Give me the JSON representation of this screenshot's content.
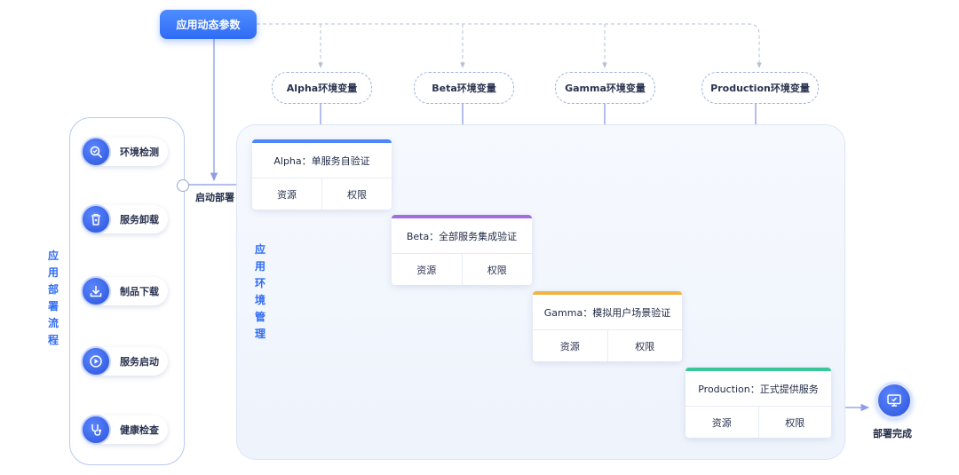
{
  "params": {
    "label": "应用动态参数"
  },
  "env_vars": [
    {
      "label": "Alpha环境变量"
    },
    {
      "label": "Beta环境变量"
    },
    {
      "label": "Gamma环境变量"
    },
    {
      "label": "Production环境变量"
    }
  ],
  "pipeline": {
    "title": "应用部署流程",
    "steps": [
      {
        "label": "环境检测",
        "icon": "search-check-icon"
      },
      {
        "label": "服务卸载",
        "icon": "trash-icon"
      },
      {
        "label": "制品下载",
        "icon": "download-icon"
      },
      {
        "label": "服务启动",
        "icon": "play-icon"
      },
      {
        "label": "健康检查",
        "icon": "stethoscope-icon"
      }
    ]
  },
  "deploy": {
    "label": "启动部署"
  },
  "env_area": {
    "title": "应用环境管理"
  },
  "stages": [
    {
      "title": "Alpha：单服务自验证",
      "resource": "资源",
      "permission": "权限",
      "color": "#4f86f7"
    },
    {
      "title": "Beta：全部服务集成验证",
      "resource": "资源",
      "permission": "权限",
      "color": "#a56ddb"
    },
    {
      "title": "Gamma：模拟用户场景验证",
      "resource": "资源",
      "permission": "权限",
      "color": "#f0b445"
    },
    {
      "title": "Production：正式提供服务",
      "resource": "资源",
      "permission": "权限",
      "color": "#39c79a"
    }
  ],
  "done": {
    "label": "部署完成",
    "icon": "monitor-check-icon"
  },
  "colors": {
    "accent": "#2f6cf5",
    "connector": "#9aa8e8",
    "dashed": "#b5c0d6"
  }
}
